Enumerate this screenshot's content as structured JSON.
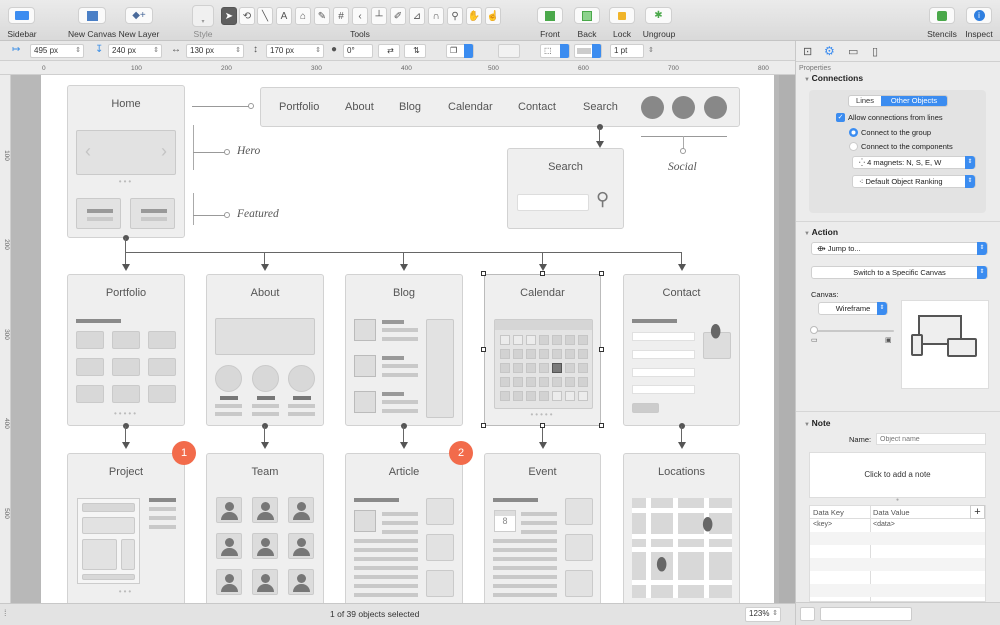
{
  "toolbar": {
    "sidebar": "Sidebar",
    "new_canvas": "New Canvas",
    "new_layer": "New Layer",
    "style": "Style",
    "tools": "Tools",
    "front": "Front",
    "back": "Back",
    "lock": "Lock",
    "ungroup": "Ungroup",
    "stencils": "Stencils",
    "inspect": "Inspect",
    "tool_icons": [
      "select-arrow",
      "lasso",
      "line",
      "text",
      "shape",
      "pen",
      "table",
      "diagram",
      "connector-tree",
      "style-brush",
      "style-pick",
      "magnet",
      "zoom",
      "grab",
      "browse"
    ]
  },
  "formatbar": {
    "x": "495 px",
    "y": "240 px",
    "width": "130 px",
    "height": "170 px",
    "rotation": "0°",
    "stroke_width": "1 pt"
  },
  "rulers": {
    "h": [
      "0",
      "100",
      "200",
      "300",
      "400",
      "500",
      "600",
      "700",
      "800"
    ],
    "v": [
      "100",
      "200",
      "300",
      "400",
      "500"
    ]
  },
  "canvas": {
    "home": {
      "title": "Home"
    },
    "nav": {
      "items": [
        "Portfolio",
        "About",
        "Blog",
        "Calendar",
        "Contact",
        "Search"
      ]
    },
    "annotations": {
      "hero": "Hero",
      "featured": "Featured",
      "social": "Social"
    },
    "search_card": {
      "title": "Search"
    },
    "row1": [
      "Portfolio",
      "About",
      "Blog",
      "Calendar",
      "Contact"
    ],
    "row2": [
      "Project",
      "Team",
      "Article",
      "Event",
      "Locations"
    ],
    "badges": [
      "1",
      "2"
    ],
    "event_date": "8",
    "colors": {
      "badge": "#f26b4b",
      "selected_day": "#7a7a7a"
    }
  },
  "status": {
    "selection": "1 of 39 objects selected",
    "zoom": "123%"
  },
  "inspector": {
    "tabs": [
      "canvas-size",
      "properties-gear",
      "layout",
      "document"
    ],
    "header": "Properties",
    "connections": {
      "title": "Connections",
      "seg_lines": "Lines",
      "seg_other": "Other Objects",
      "allow": "Allow connections from lines",
      "group": "Connect to the group",
      "components": "Connect to the components",
      "magnets": "4 magnets: N, S, E, W",
      "ranking": "Default Object Ranking"
    },
    "action": {
      "title": "Action",
      "jump": "Jump to...",
      "switch": "Switch to a Specific Canvas",
      "canvas_label": "Canvas:",
      "canvas_value": "Wireframe"
    },
    "note": {
      "title": "Note",
      "name_label": "Name:",
      "name_placeholder": "Object name",
      "note_placeholder": "Click to add a note",
      "col_key": "Data Key",
      "col_value": "Data Value",
      "add": "+",
      "rows": [
        {
          "key": "<key>",
          "value": "<data>"
        }
      ]
    }
  }
}
